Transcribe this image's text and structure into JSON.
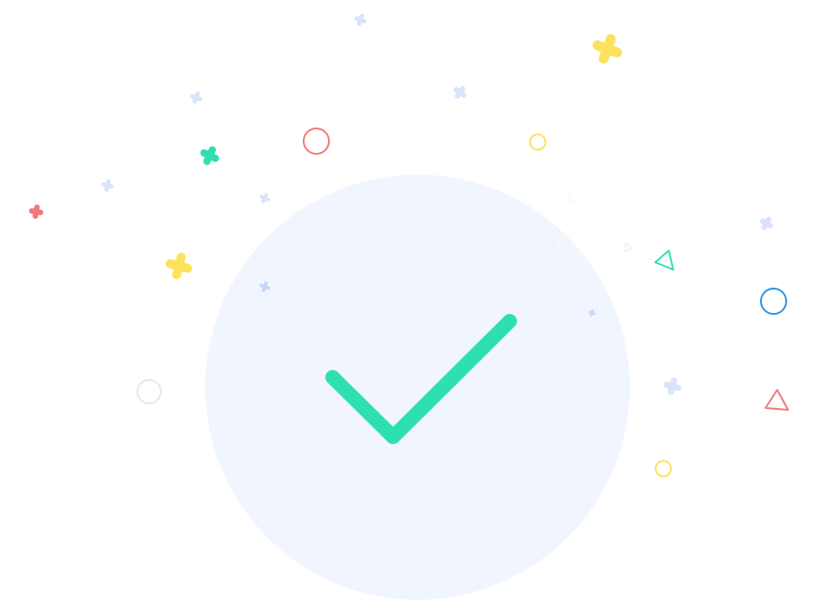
{
  "illustration": {
    "type": "success-confetti",
    "colors": {
      "background": "#ffffff",
      "circle_fill": "#f1f6fe",
      "check": "#2ee0b0",
      "yellow": "#fde25e",
      "red": "#f07a78",
      "teal": "#2ee0b0",
      "blue": "#2a94e6",
      "pale_blue": "#d9e4fb",
      "faint": "#e8eef8"
    },
    "icons": [
      "check-icon",
      "sparkle-icon",
      "ring-icon",
      "triangle-icon"
    ]
  }
}
